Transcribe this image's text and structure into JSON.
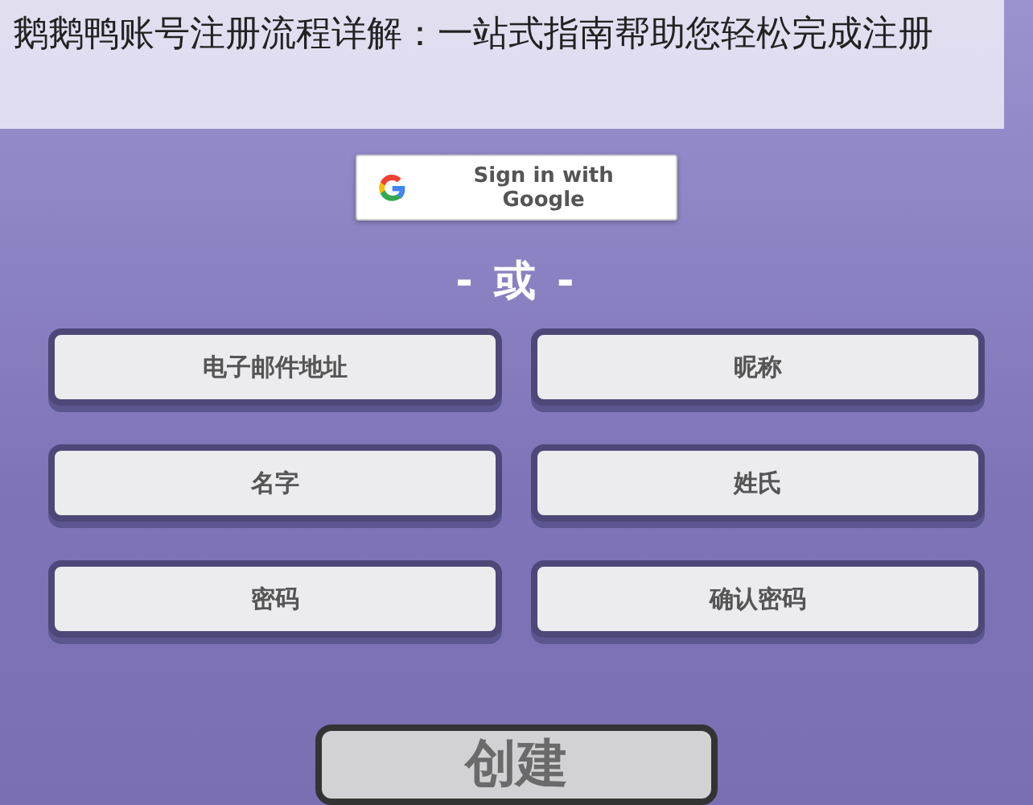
{
  "caption": "鹅鹅鸭账号注册流程详解：一站式指南帮助您轻松完成注册",
  "google_button": {
    "label": "Sign in with Google"
  },
  "divider": "- 或 -",
  "fields": [
    {
      "placeholder": "电子邮件地址"
    },
    {
      "placeholder": "昵称"
    },
    {
      "placeholder": "名字"
    },
    {
      "placeholder": "姓氏"
    },
    {
      "placeholder": "密码"
    },
    {
      "placeholder": "确认密码"
    }
  ],
  "create_button": {
    "label": "创建"
  }
}
